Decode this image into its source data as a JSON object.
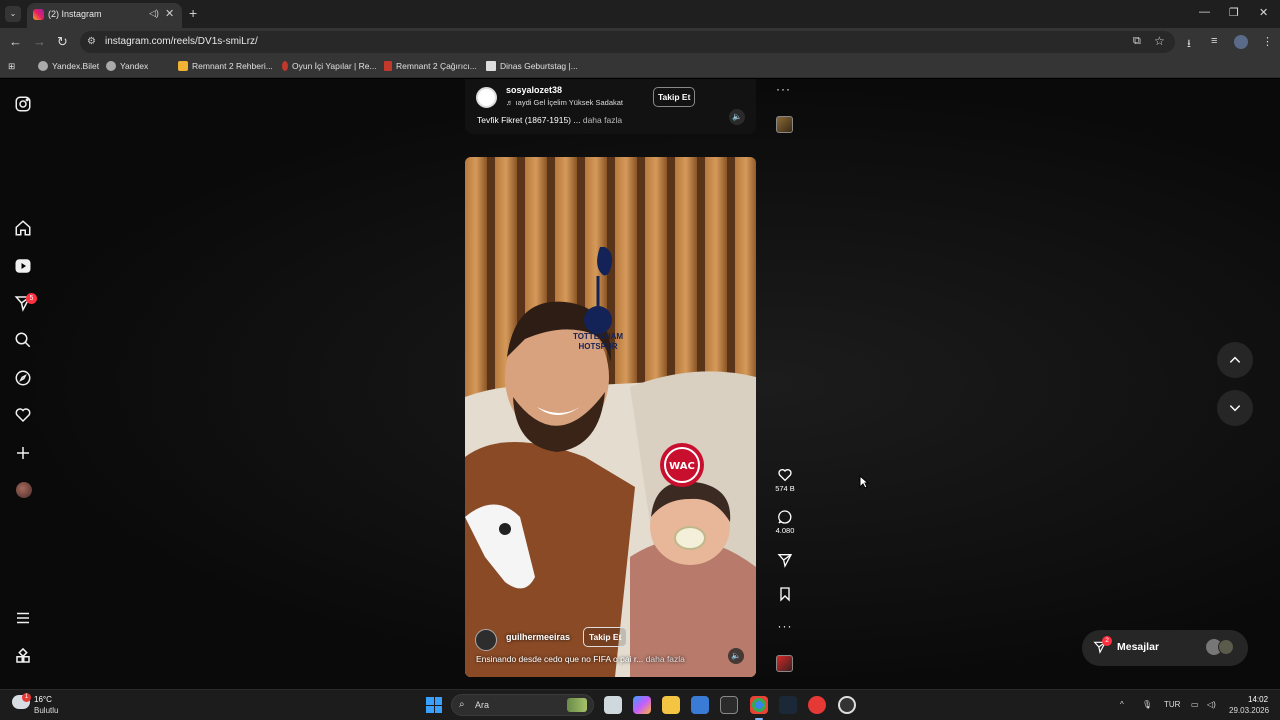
{
  "browser": {
    "tab_title": "(2) Instagram",
    "url": "instagram.com/reels/DV1s-smiLrz/",
    "bookmarks": [
      {
        "label": "Yandex.Bilet",
        "color": "#aaaaaa"
      },
      {
        "label": "Yandex",
        "color": "#aaaaaa"
      },
      {
        "label": "Remnant 2 Rehberi...",
        "color": "#f2b233"
      },
      {
        "label": "Oyun İçi Yapılar | Re...",
        "color": "#c0392b"
      },
      {
        "label": "Remnant 2 Çağırıcı...",
        "color": "#c0392b"
      },
      {
        "label": "Dinas Geburtstag |...",
        "color": "#dddddd"
      }
    ]
  },
  "sidebar": {
    "notification_count": "5"
  },
  "reel_prev": {
    "username": "sosyalozet38",
    "music": "♬  ıaydi Gel İçelim   Yüksek Sadakat",
    "follow_label": "Takip Et",
    "caption": "Tevfik Fikret (1867-1915) ...",
    "more": "daha fazla"
  },
  "reel": {
    "username": "guilhermeeiras",
    "follow_label": "Takip Et",
    "caption": "Ensinando desde cedo que no FIFA o pai r...",
    "more": "daha fazla",
    "sticker_top": "TOTTENHAM HOTSPUR",
    "likes": "574 B",
    "comments": "4.080"
  },
  "messages": {
    "label": "Mesajlar",
    "badge": "2"
  },
  "taskbar": {
    "weather_temp": "16°C",
    "weather_desc": "Bulutlu",
    "weather_badge": "1",
    "search_label": "Ara",
    "lang": "TUR",
    "time": "14:02",
    "date": "29.03.2026"
  },
  "colors": {
    "accent_badge": "#ff3040",
    "page_bg": "#000000"
  }
}
